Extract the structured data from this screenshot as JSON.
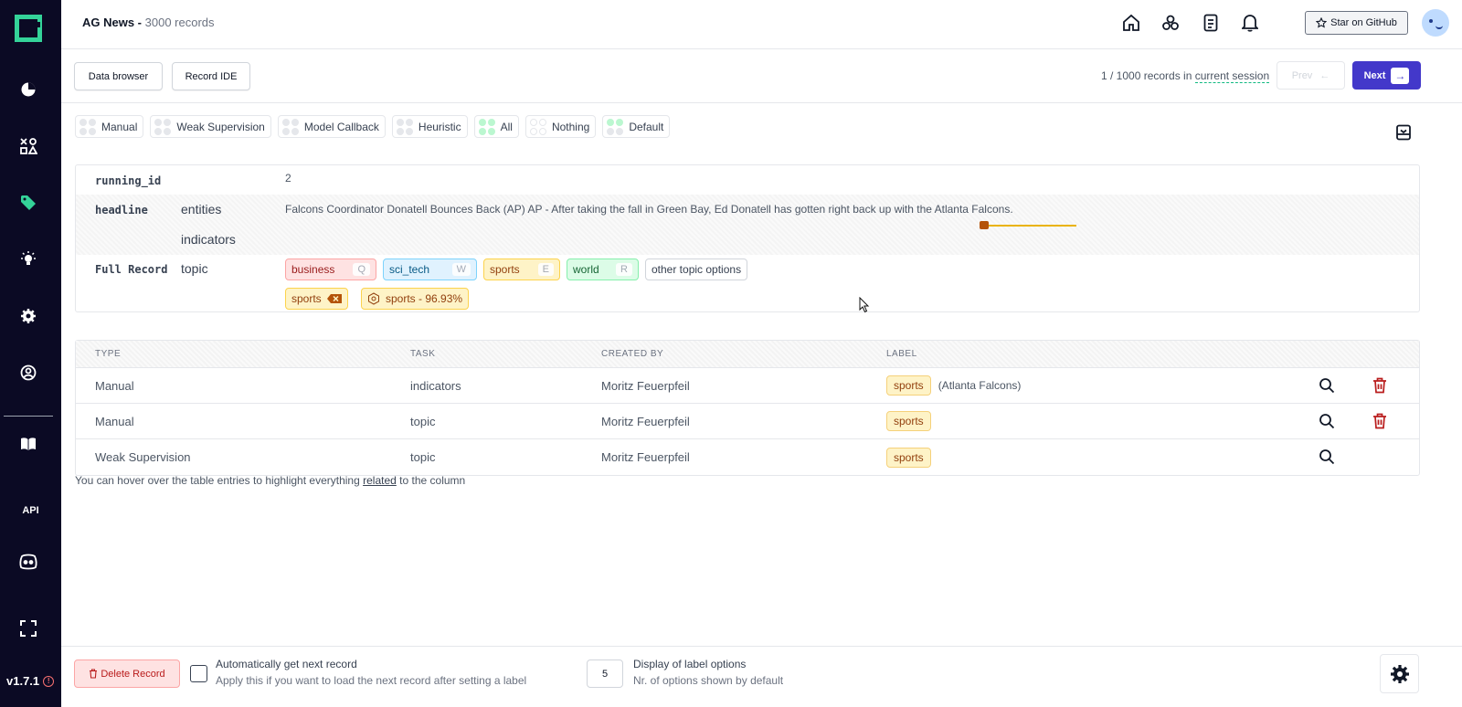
{
  "header": {
    "project_name": "AG News -",
    "record_count": "3000 records",
    "star_label": "Star on GitHub"
  },
  "toolbar": {
    "data_browser": "Data browser",
    "record_ide": "Record IDE",
    "session_prefix": "1 / 1000 records in",
    "session_link": "current session",
    "prev_label": "Prev",
    "next_label": "Next"
  },
  "filters": [
    {
      "label": "Manual",
      "dots": [
        "#e5e7eb",
        "#e5e7eb",
        "#e5e7eb",
        "#e5e7eb"
      ]
    },
    {
      "label": "Weak Supervision",
      "dots": [
        "#e5e7eb",
        "#e5e7eb",
        "#e5e7eb",
        "#e5e7eb"
      ]
    },
    {
      "label": "Model Callback",
      "dots": [
        "#e5e7eb",
        "#e5e7eb",
        "#e5e7eb",
        "#e5e7eb"
      ]
    },
    {
      "label": "Heuristic",
      "dots": [
        "#e5e7eb",
        "#e5e7eb",
        "#e5e7eb",
        "#e5e7eb"
      ]
    },
    {
      "label": "All",
      "dots": [
        "#bbf7d0",
        "#bbf7d0",
        "#bbf7d0",
        "#bbf7d0"
      ]
    },
    {
      "label": "Nothing",
      "dots": [
        "#ffffff",
        "#ffffff",
        "#ffffff",
        "#ffffff"
      ]
    },
    {
      "label": "Default",
      "dots": [
        "#bbf7d0",
        "#bbf7d0",
        "#e5e7eb",
        "#e5e7eb"
      ]
    }
  ],
  "record": {
    "running_id_key": "running_id",
    "running_id_value": "2",
    "headline_key": "headline",
    "task_entities": "entities",
    "task_indicators": "indicators",
    "headline_text": "Falcons Coordinator Donatell Bounces Back (AP) AP - After taking the fall in Green Bay, Ed Donatell has gotten right back up with the Atlanta Falcons.",
    "full_record_key": "Full Record",
    "task_topic": "topic",
    "topic_options": [
      {
        "label": "business",
        "key": "Q",
        "color": "#fee2e2",
        "border": "#fca5a5",
        "text": "#991b1b"
      },
      {
        "label": "sci_tech",
        "key": "W",
        "color": "#e0f2fe",
        "border": "#7dd3fc",
        "text": "#075985"
      },
      {
        "label": "sports",
        "key": "E",
        "color": "#fef3c7",
        "border": "#fcd34d",
        "text": "#92400e"
      },
      {
        "label": "world",
        "key": "R",
        "color": "#dcfce7",
        "border": "#86efac",
        "text": "#166534"
      }
    ],
    "other_options": "other topic options",
    "set_label": "sports",
    "prediction": "sports - 96.93%"
  },
  "table": {
    "headers": [
      "TYPE",
      "TASK",
      "CREATED BY",
      "LABEL"
    ],
    "rows": [
      {
        "type": "Manual",
        "task": "indicators",
        "created_by": "Moritz Feuerpfeil",
        "label": "sports",
        "extra": "(Atlanta Falcons)",
        "deletable": true
      },
      {
        "type": "Manual",
        "task": "topic",
        "created_by": "Moritz Feuerpfeil",
        "label": "sports",
        "extra": "",
        "deletable": true
      },
      {
        "type": "Weak Supervision",
        "task": "topic",
        "created_by": "Moritz Feuerpfeil",
        "label": "sports",
        "extra": "",
        "deletable": false
      }
    ],
    "hint_before": "You can hover over the table entries to highlight everything",
    "hint_link": "related",
    "hint_after": "to the column"
  },
  "footer": {
    "delete_label": "Delete Record",
    "auto_next_title": "Automatically get next record",
    "auto_next_desc": "Apply this if you want to load the next record after setting a label",
    "options_count": "5",
    "display_title": "Display of label options",
    "display_desc": "Nr. of options shown by default"
  },
  "sidebar": {
    "api_label": "API",
    "version": "v1.7.1"
  }
}
